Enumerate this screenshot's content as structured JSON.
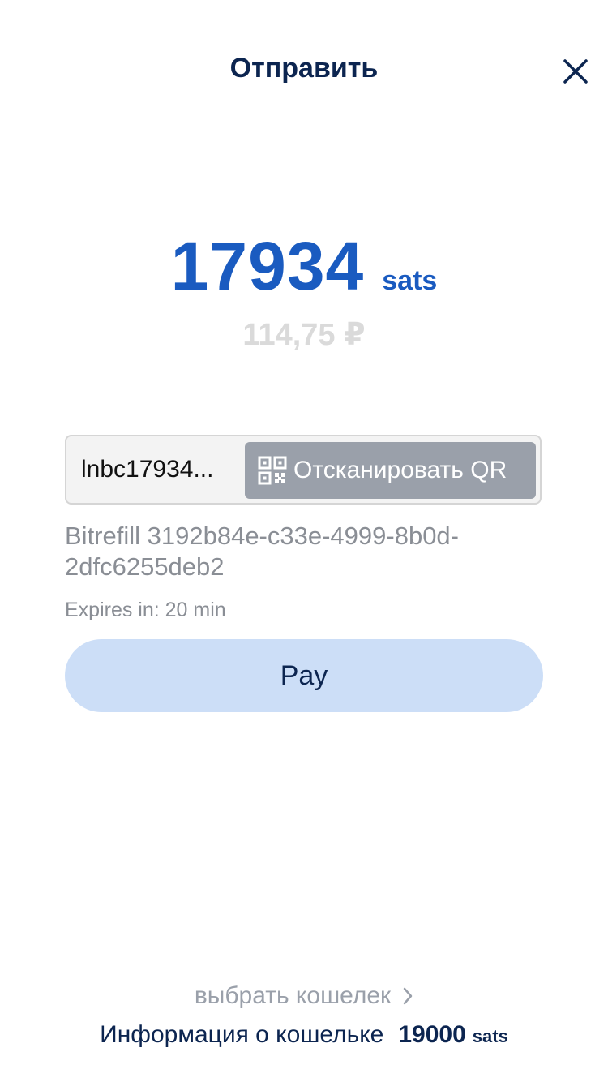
{
  "header": {
    "title": "Отправить",
    "close_icon": "close-icon"
  },
  "amount": {
    "value": "17934",
    "unit": "sats",
    "fiat": "114,75 ₽"
  },
  "invoice": {
    "address_value": "lnbc17934...",
    "scan_label": "Отсканировать QR",
    "scan_icon": "qr-code-icon",
    "description": "Bitrefill 3192b84e-c33e-4999-8b0d-2dfc6255deb2",
    "expires": "Expires in: 20 min"
  },
  "actions": {
    "pay_label": "Pay"
  },
  "footer": {
    "choose_wallet_label": "выбрать кошелек",
    "choose_wallet_icon": "chevron-right-icon",
    "wallet_info_label": "Информация о кошельке",
    "wallet_balance": "19000",
    "wallet_unit": "sats"
  },
  "colors": {
    "primary": "#1a5bc0",
    "navy": "#0c2550",
    "muted": "#8a8e95",
    "pay_button_bg": "#ccdef7",
    "scan_button_bg": "#9aa0aa"
  }
}
